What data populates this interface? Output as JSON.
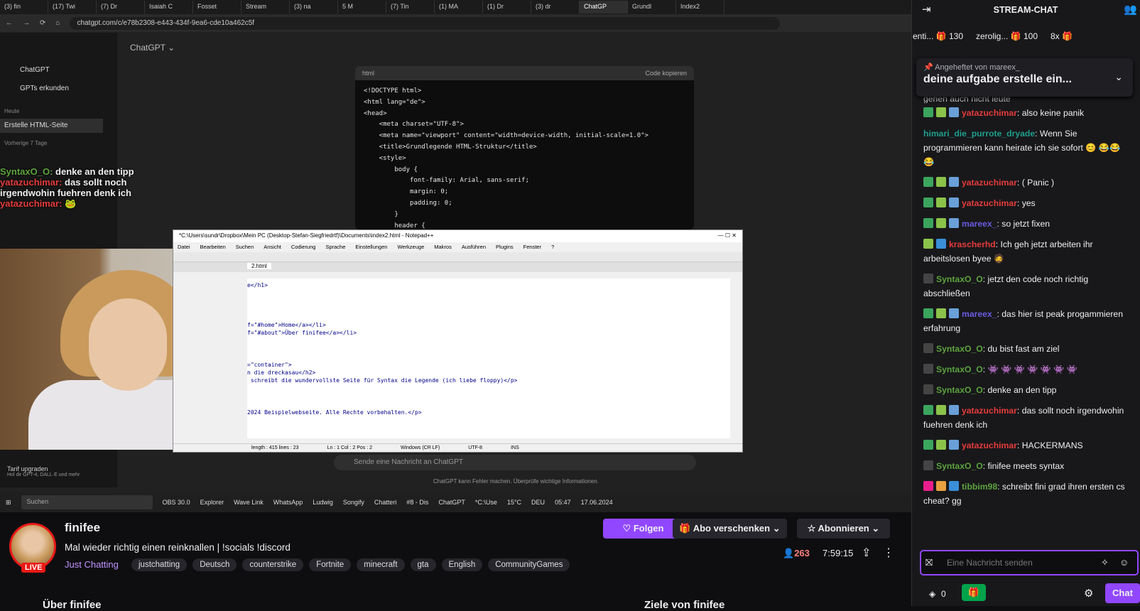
{
  "browser": {
    "tabs": [
      "(3) fin",
      "(17) Twi",
      "(7) Dr",
      "Isaiah C",
      "Fosset",
      "Stream",
      "(3) na",
      "5 M",
      "(7) Tin",
      "(1) MA",
      "(1) Dr",
      "(3) dr",
      "ChatGP",
      "Grundl",
      "Index2"
    ],
    "url": "chatgpt.com/c/e78b2308-e443-434f-9ea6-cde10a462c5f"
  },
  "chatgpt": {
    "model": "ChatGPT ⌄",
    "sidebar": [
      "ChatGPT",
      "GPTs erkunden"
    ],
    "today_label": "Heute",
    "active_chat": "Erstelle HTML-Seite",
    "prev_label": "Vorherige 7 Tage",
    "code_lang": "html",
    "copy_label": "Code kopieren",
    "code": "<!DOCTYPE html>\n<html lang=\"de\">\n<head>\n    <meta charset=\"UTF-8\">\n    <meta name=\"viewport\" content=\"width=device-width, initial-scale=1.0\">\n    <title>Grundlegende HTML-Struktur</title>\n    <style>\n        body {\n            font-family: Arial, sans-serif;\n            margin: 0;\n            padding: 0;\n        }\n        header {",
    "input_placeholder": "Sende eine Nachricht an ChatGPT",
    "disclaimer": "ChatGPT kann Fehler machen. Überprüfe wichtige Informationen.",
    "upgrade": "Tarif upgraden",
    "upgrade_sub": "Hol dir GPT-4, DALL·E und mehr"
  },
  "notepad": {
    "title": "*C:\\Users\\sundr\\Dropbox\\Mein PC (Desktop-Stefan-Siegfriedrtf)\\Documents\\index2.html - Notepad++",
    "menu": [
      "Datei",
      "Bearbeiten",
      "Suchen",
      "Ansicht",
      "Codierung",
      "Sprache",
      "Einstellungen",
      "Werkzeuge",
      "Makros",
      "Ausführen",
      "Plugins",
      "Fenster",
      "?"
    ],
    "tab": "2.html",
    "code": "e</h1>\n\n\n\n\nf=\"#home\">Home</a></li>\nf=\"#about\">Über finifee</a></li>\n\n\n\n=\"container\">\nn die dreckasau</h2>\n schreibt die wundervollste Seite für Syntax die Legende (ich liebe floppy)</p>\n\n\n\n2024 Beispielwebseite. Alle Rechte vorbehalten.</p>",
    "status": [
      "length : 415   lines : 23",
      "Ln : 1   Col : 2   Pos : 2",
      "Windows (CR LF)",
      "UTF-8",
      "INS"
    ]
  },
  "overlay_chat": [
    {
      "user": "SyntaxO_O:",
      "text": "denke an den tipp",
      "color": "#5ca33d"
    },
    {
      "user": "yatazuchimar:",
      "text": "das sollt noch irgendwohin fuehren denk ich",
      "color": "#e63b3b"
    },
    {
      "user": "yatazuchimar:",
      "text": "🐸",
      "color": "#e63b3b"
    }
  ],
  "taskbar": {
    "search": "Suchen",
    "apps": [
      "OBS 30.0",
      "Explorer",
      "Wave Link",
      "WhatsApp",
      "Ludwig",
      "Songify",
      "Chatteri",
      "#8 - Dis",
      "ChatGPT",
      "*C:\\Use"
    ],
    "weather": "15°C",
    "lang": "DEU",
    "time": "05:47",
    "date": "17.06.2024"
  },
  "channel": {
    "name": "finifee",
    "live_badge": "LIVE",
    "title": "Mal wieder richtig einen reinknallen | !socials !discord",
    "category": "Just Chatting",
    "tags": [
      "justchatting",
      "Deutsch",
      "counterstrike",
      "Fortnite",
      "minecraft",
      "gta",
      "English",
      "CommunityGames"
    ],
    "follow_label": "Folgen",
    "gift_label": "Abo verschenken",
    "subscribe_label": "Abonnieren",
    "viewers": "263",
    "uptime": "7:59:15",
    "about": "Über finifee",
    "goals": "Ziele von finifee"
  },
  "chat": {
    "header": "STREAM-CHAT",
    "leaderboard": [
      {
        "name": "enti...",
        "value": "130"
      },
      {
        "name": "zerolig...",
        "value": "100"
      },
      {
        "name": "8x",
        "value": ""
      }
    ],
    "pinned_by": "Angeheftet von mareex_",
    "pinned_text": "deine aufgabe erstelle ein...",
    "partial_top": "gehen auch nicht leute",
    "messages": [
      {
        "user": "yatazuchimar",
        "color": "#e63b3b",
        "text": "also keine panik",
        "badges": [
          "#3ba55d",
          "#8bc34a",
          "#6a9fd8"
        ]
      },
      {
        "user": "himari_die_purrote_dryade",
        "color": "#1e9e8c",
        "text": "Wenn Sie programmieren kann heirate ich sie sofort 😊 😂😂😂",
        "badges": []
      },
      {
        "user": "yatazuchimar",
        "color": "#e63b3b",
        "text": "( Panic )",
        "badges": [
          "#3ba55d",
          "#8bc34a",
          "#6a9fd8"
        ]
      },
      {
        "user": "yatazuchimar",
        "color": "#e63b3b",
        "text": "yes",
        "badges": [
          "#3ba55d",
          "#8bc34a",
          "#6a9fd8"
        ]
      },
      {
        "user": "mareex_",
        "color": "#6a5ae0",
        "text": "so jetzt fixen",
        "badges": [
          "#3ba55d",
          "#8bc34a",
          "#6a9fd8"
        ]
      },
      {
        "user": "krascherhd",
        "color": "#e63b3b",
        "text": "Ich geh jetzt arbeiten ihr arbeitslosen byee 🧔",
        "badges": [
          "#8bc34a",
          "#3a8fd8"
        ]
      },
      {
        "user": "SyntaxO_O",
        "color": "#5ca33d",
        "text": "jetzt den code noch richtig abschließen",
        "badges": [
          "#444"
        ]
      },
      {
        "user": "mareex_",
        "color": "#6a5ae0",
        "text": "das hier ist peak progammieren erfahrung",
        "badges": [
          "#3ba55d",
          "#8bc34a",
          "#6a9fd8"
        ]
      },
      {
        "user": "SyntaxO_O",
        "color": "#5ca33d",
        "text": "du bist fast am ziel",
        "badges": [
          "#444"
        ]
      },
      {
        "user": "SyntaxO_O",
        "color": "#5ca33d",
        "text": "👾 👾 👾 👾 👾 👾 👾",
        "badges": [
          "#444"
        ]
      },
      {
        "user": "SyntaxO_O",
        "color": "#5ca33d",
        "text": "denke an den tipp",
        "badges": [
          "#444"
        ]
      },
      {
        "user": "yatazuchimar",
        "color": "#e63b3b",
        "text": "das sollt noch irgendwohin fuehren denk ich",
        "badges": [
          "#3ba55d",
          "#8bc34a",
          "#6a9fd8"
        ]
      },
      {
        "user": "yatazuchimar",
        "color": "#e63b3b",
        "text": "HACKERMANS",
        "badges": [
          "#3ba55d",
          "#8bc34a",
          "#6a9fd8"
        ]
      },
      {
        "user": "SyntaxO_O",
        "color": "#5ca33d",
        "text": "finifee meets syntax",
        "badges": [
          "#444"
        ]
      },
      {
        "user": "tibbim98",
        "color": "#5ca33d",
        "text": "schreibt fini grad ihren ersten cs cheat? gg",
        "badges": [
          "#e91e8c",
          "#e8a040",
          "#3a8fd8"
        ]
      }
    ],
    "input_placeholder": "Eine Nachricht senden",
    "points": "0",
    "send_label": "Chat"
  },
  "colors": {
    "accent": "#9147ff",
    "live": "#e91916",
    "bg": "#0e0e10",
    "chat_bg": "#18181b"
  }
}
